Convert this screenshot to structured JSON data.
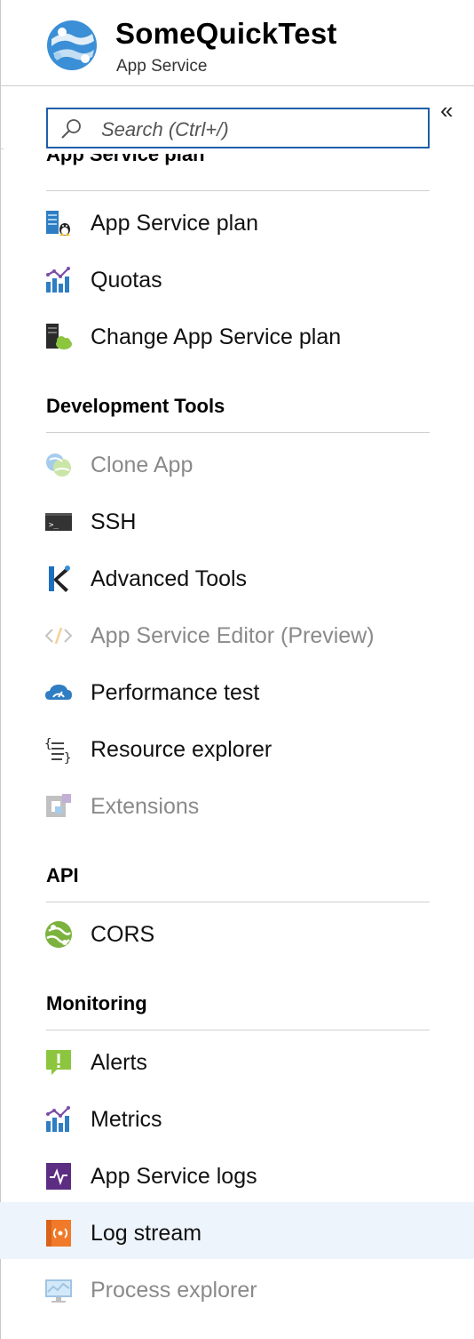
{
  "header": {
    "title": "SomeQuickTest",
    "subtitle": "App Service",
    "logo_icon": "app-service-globe-icon",
    "collapse_glyph": "«"
  },
  "search": {
    "placeholder": "Search (Ctrl+/)"
  },
  "colors": {
    "accent": "#1f5fa8",
    "selected_bg": "#eef4fb",
    "disabled_text": "#8a8a8a",
    "rule": "#cfcfcf"
  },
  "menu": {
    "partial_section": "App Service plan",
    "app_service_plan": [
      {
        "label": "App Service plan",
        "icon": "server-linux-icon"
      },
      {
        "label": "Quotas",
        "icon": "chart-icon"
      },
      {
        "label": "Change App Service plan",
        "icon": "server-cloud-icon"
      }
    ],
    "development_tools": {
      "title": "Development Tools",
      "items": [
        {
          "label": "Clone App",
          "icon": "clone-icon",
          "disabled": true
        },
        {
          "label": "SSH",
          "icon": "terminal-icon"
        },
        {
          "label": "Advanced Tools",
          "icon": "kudu-icon"
        },
        {
          "label": "App Service Editor (Preview)",
          "icon": "code-icon",
          "disabled": true
        },
        {
          "label": "Performance test",
          "icon": "cloud-gauge-icon"
        },
        {
          "label": "Resource explorer",
          "icon": "braces-list-icon"
        },
        {
          "label": "Extensions",
          "icon": "extension-icon",
          "disabled": true
        }
      ]
    },
    "api": {
      "title": "API",
      "items": [
        {
          "label": "CORS",
          "icon": "cors-globe-icon"
        }
      ]
    },
    "monitoring": {
      "title": "Monitoring",
      "items": [
        {
          "label": "Alerts",
          "icon": "alert-icon"
        },
        {
          "label": "Metrics",
          "icon": "chart-icon"
        },
        {
          "label": "App Service logs",
          "icon": "pulse-log-icon"
        },
        {
          "label": "Log stream",
          "icon": "log-stream-icon",
          "selected": true
        },
        {
          "label": "Process explorer",
          "icon": "monitor-icon",
          "disabled": true
        }
      ]
    }
  }
}
